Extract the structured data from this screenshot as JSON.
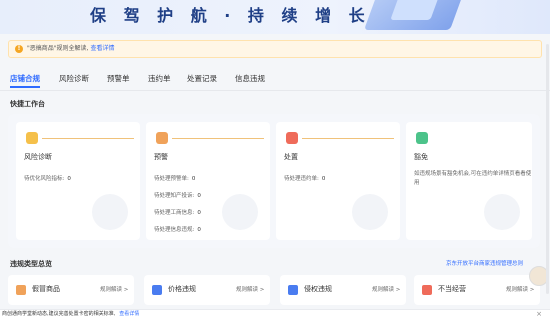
{
  "banner": {
    "title": "保 驾 护 航 · 持 续 增 长"
  },
  "notice": {
    "text": "\"恶搞商品\"规则全解读,",
    "link": "查看详情"
  },
  "tabs": [
    {
      "label": "店铺合规",
      "active": true
    },
    {
      "label": "风险诊断",
      "active": false
    },
    {
      "label": "预警单",
      "active": false
    },
    {
      "label": "违约单",
      "active": false
    },
    {
      "label": "处置记录",
      "active": false
    },
    {
      "label": "信息违规",
      "active": false
    }
  ],
  "workbench": {
    "title": "快捷工作台",
    "stages": [
      {
        "name": "风险诊断",
        "icon": "risk-diagnosis-icon",
        "color": "#f5c04a",
        "items": [
          {
            "label": "待优化风险指标:",
            "value": "0"
          }
        ]
      },
      {
        "name": "预警",
        "icon": "warning-icon",
        "color": "#f0a25a",
        "items": [
          {
            "label": "待处理预警单:",
            "value": "0"
          },
          {
            "label": "待处理知产投诉:",
            "value": "0"
          },
          {
            "label": "待处理工商信息:",
            "value": "0"
          },
          {
            "label": "待处理信息违规:",
            "value": "0"
          }
        ]
      },
      {
        "name": "处置",
        "icon": "disposal-icon",
        "color": "#ef6b5a",
        "items": [
          {
            "label": "待处理违约单:",
            "value": "0"
          }
        ]
      },
      {
        "name": "豁免",
        "icon": "exemption-icon",
        "color": "#4cc38a",
        "desc": "如违规场景有豁免机会,可在违约单详情页看看使用"
      }
    ]
  },
  "violation_types": {
    "title": "违规类型总览",
    "link": "京东开放平台商家违规管理总则",
    "cards": [
      {
        "name": "假冒商品",
        "rule": "规则解读 >",
        "icon": "counterfeit-icon",
        "color": "#f0a25a"
      },
      {
        "name": "价格违规",
        "rule": "规则解读 >",
        "icon": "price-icon",
        "color": "#4a7cf0"
      },
      {
        "name": "侵权违规",
        "rule": "规则解读 >",
        "icon": "infringement-icon",
        "color": "#4a7cf0"
      },
      {
        "name": "不当经营",
        "rule": "规则解读 >",
        "icon": "improper-icon",
        "color": "#ef6b5a"
      }
    ]
  },
  "bottom_bar": {
    "text": "商创通商学堂新动态,建议完善处置卡密的相关标准,",
    "link": "查看详情"
  }
}
